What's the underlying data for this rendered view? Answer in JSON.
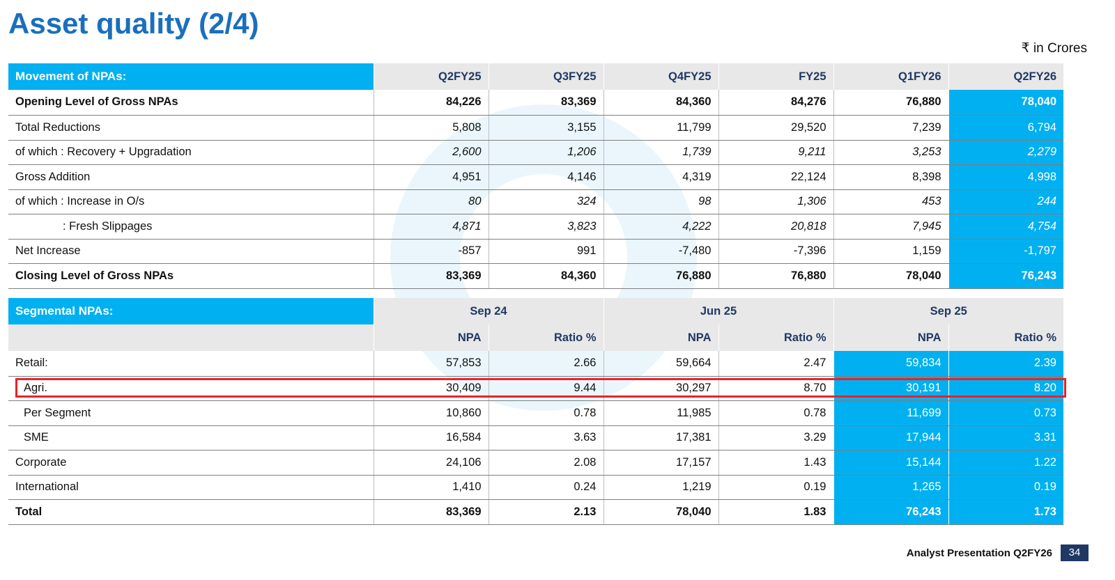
{
  "title": "Asset quality (2/4)",
  "unit_label": "₹ in Crores",
  "movement": {
    "header": "Movement of NPAs:",
    "columns": [
      "Q2FY25",
      "Q3FY25",
      "Q4FY25",
      "FY25",
      "Q1FY26",
      "Q2FY26"
    ],
    "rows": [
      {
        "label": "Opening Level of Gross NPAs",
        "values": [
          "84,226",
          "83,369",
          "84,360",
          "84,276",
          "76,880",
          "78,040"
        ]
      },
      {
        "label": "Total Reductions",
        "values": [
          "5,808",
          "3,155",
          "11,799",
          "29,520",
          "7,239",
          "6,794"
        ]
      },
      {
        "label": "of which : Recovery + Upgradation",
        "values": [
          "2,600",
          "1,206",
          "1,739",
          "9,211",
          "3,253",
          "2,279"
        ]
      },
      {
        "label": "Gross Addition",
        "values": [
          "4,951",
          "4,146",
          "4,319",
          "22,124",
          "8,398",
          "4,998"
        ]
      },
      {
        "label": "of which : Increase in O/s",
        "values": [
          "80",
          "324",
          "98",
          "1,306",
          "453",
          "244"
        ]
      },
      {
        "label": ": Fresh Slippages",
        "values": [
          "4,871",
          "3,823",
          "4,222",
          "20,818",
          "7,945",
          "4,754"
        ]
      },
      {
        "label": "Net Increase",
        "values": [
          "-857",
          "991",
          "-7,480",
          "-7,396",
          "1,159",
          "-1,797"
        ]
      },
      {
        "label": "Closing Level of Gross NPAs",
        "values": [
          "83,369",
          "84,360",
          "76,880",
          "76,880",
          "78,040",
          "76,243"
        ]
      }
    ]
  },
  "segmental": {
    "header": "Segmental NPAs:",
    "groups": [
      "Sep 24",
      "Jun 25",
      "Sep 25"
    ],
    "subcolumns": [
      "NPA",
      "Ratio %",
      "NPA",
      "Ratio %",
      "NPA",
      "Ratio %"
    ],
    "rows": [
      {
        "label": "Retail:",
        "values": [
          "57,853",
          "2.66",
          "59,664",
          "2.47",
          "59,834",
          "2.39"
        ]
      },
      {
        "label": "Agri.",
        "values": [
          "30,409",
          "9.44",
          "30,297",
          "8.70",
          "30,191",
          "8.20"
        ]
      },
      {
        "label": "Per Segment",
        "values": [
          "10,860",
          "0.78",
          "11,985",
          "0.78",
          "11,699",
          "0.73"
        ]
      },
      {
        "label": "SME",
        "values": [
          "16,584",
          "3.63",
          "17,381",
          "3.29",
          "17,944",
          "3.31"
        ]
      },
      {
        "label": "Corporate",
        "values": [
          "24,106",
          "2.08",
          "17,157",
          "1.43",
          "15,144",
          "1.22"
        ]
      },
      {
        "label": "International",
        "values": [
          "1,410",
          "0.24",
          "1,219",
          "0.19",
          "1,265",
          "0.19"
        ]
      },
      {
        "label": "Total",
        "values": [
          "83,369",
          "2.13",
          "78,040",
          "1.83",
          "76,243",
          "1.73"
        ]
      }
    ]
  },
  "footer": {
    "text": "Analyst Presentation Q2FY26",
    "page": "34"
  },
  "colors": {
    "title": "#1a6fbd",
    "header_bg": "#00b0f0",
    "highlight_box": "#e8232a",
    "page_badge": "#1f3864"
  }
}
